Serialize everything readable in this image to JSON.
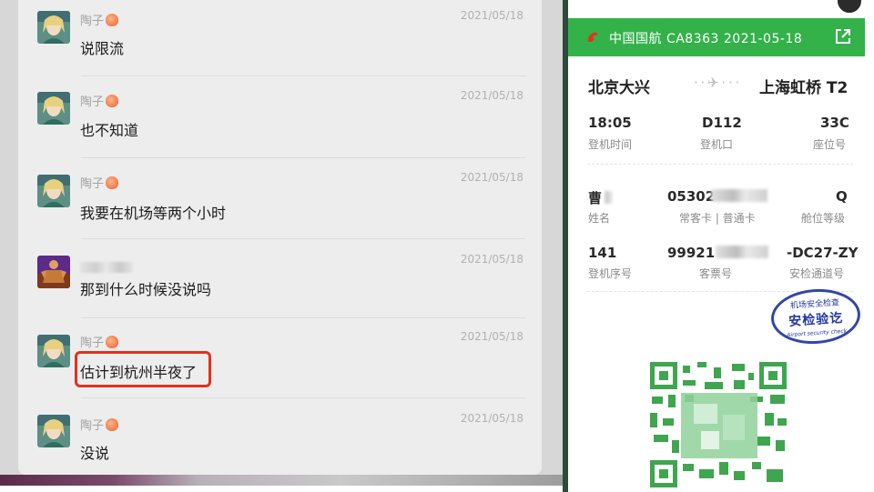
{
  "chat": {
    "messages": [
      {
        "name": "陶子",
        "time": "2021/05/18",
        "text": "说限流"
      },
      {
        "name": "陶子",
        "time": "2021/05/18",
        "text": "也不知道"
      },
      {
        "name": "陶子",
        "time": "2021/05/18",
        "text": "我要在机场等两个小时"
      },
      {
        "name": "",
        "time": "2021/05/18",
        "text": "那到什么时候没说吗"
      },
      {
        "name": "陶子",
        "time": "2021/05/18",
        "text": "估计到杭州半夜了"
      },
      {
        "name": "陶子",
        "time": "2021/05/18",
        "text": "没说"
      }
    ]
  },
  "pass": {
    "header_title": "中国国航 CA8363   2021-05-18",
    "from": "北京大兴",
    "to": "上海虹桥 T2",
    "row1": [
      {
        "value": "18:05",
        "label": "登机时间"
      },
      {
        "value": "D112",
        "label": "登机口"
      },
      {
        "value": "33C",
        "label": "座位号"
      }
    ],
    "row2": [
      {
        "value": "曹",
        "label": "姓名"
      },
      {
        "value": "05302",
        "label": "常客卡 | 普通卡"
      },
      {
        "value": "Q",
        "label": "舱位等级"
      }
    ],
    "row3": [
      {
        "value": "141",
        "label": "登机序号"
      },
      {
        "value": "99921",
        "label": "客票号"
      },
      {
        "value": "-DC27-ZY",
        "label": "安检通道号"
      }
    ],
    "stamp": {
      "top": "机场安全检查",
      "main": "安检验讫",
      "bottom": "Airport security check"
    },
    "brand_color": "#33b24a"
  },
  "colors": {
    "highlight": "#e5301d",
    "stamp": "#2438a0"
  }
}
